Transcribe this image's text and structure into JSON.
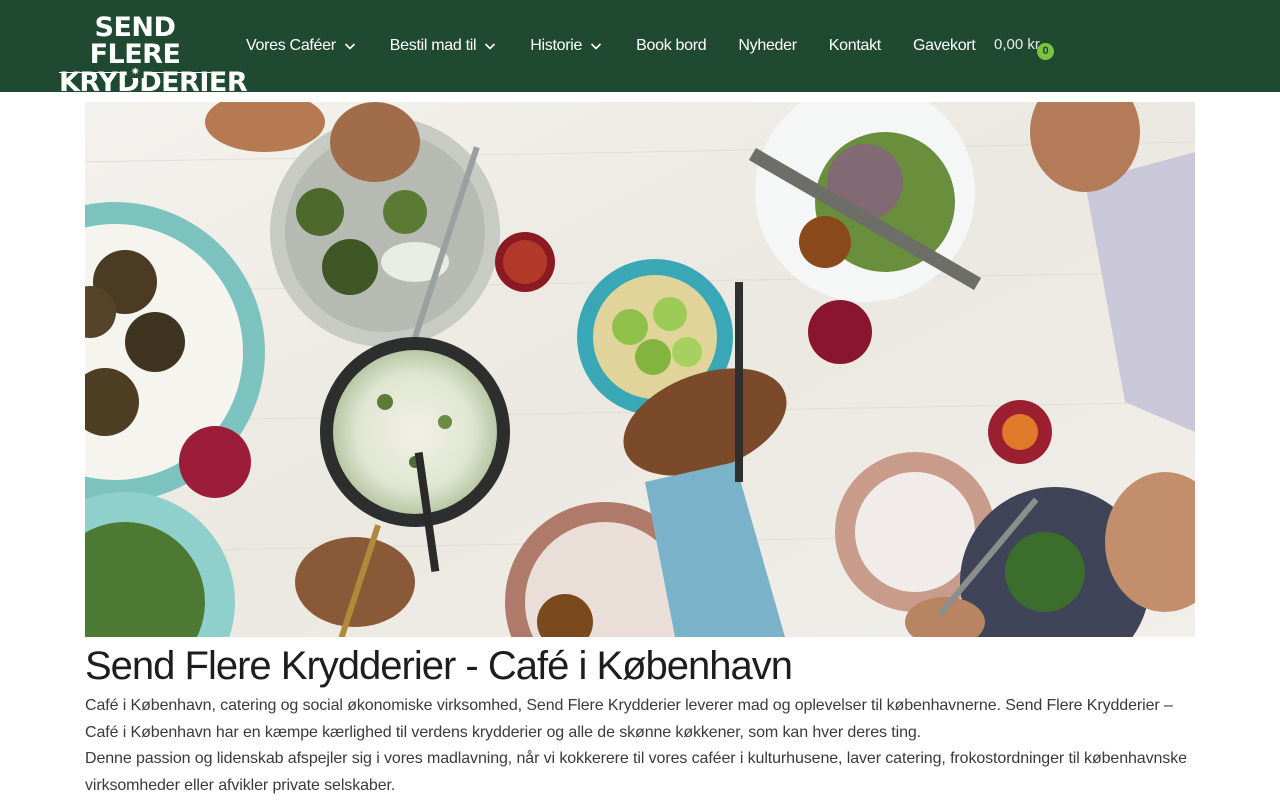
{
  "header": {
    "logo": {
      "line1": "SEND FLERE",
      "line2": "KRYDDERIER",
      "star": "✷"
    },
    "nav": [
      {
        "label": "Vores Caféer",
        "dropdown": true
      },
      {
        "label": "Bestil mad til",
        "dropdown": true
      },
      {
        "label": "Historie",
        "dropdown": true
      },
      {
        "label": "Book bord",
        "dropdown": false
      },
      {
        "label": "Nyheder",
        "dropdown": false
      },
      {
        "label": "Kontakt",
        "dropdown": false
      },
      {
        "label": "Gavekort",
        "dropdown": false
      }
    ],
    "cart": {
      "amount": "0,00 kr",
      "count": "0"
    },
    "colors": {
      "header_bg": "#1f4a31",
      "badge": "#7cc242"
    }
  },
  "hero": {
    "icon": "food-table-photo"
  },
  "main": {
    "title": "Send Flere Krydderier - Café i København",
    "paragraphs": [
      "Café i København, catering og social økonomiske virksomhed, Send Flere Krydderier leverer mad og oplevelser til københavnerne. Send Flere Krydderier – Café i København har en kæmpe kærlighed til verdens krydderier og alle de skønne køkkener, som kan hver deres ting.",
      "Denne passion og lidenskab afspejler sig i vores madlavning, når vi kokkerere til vores caféer i kulturhusene, laver catering, frokostordninger til københavnske virksomheder eller afvikler private selskaber."
    ]
  }
}
